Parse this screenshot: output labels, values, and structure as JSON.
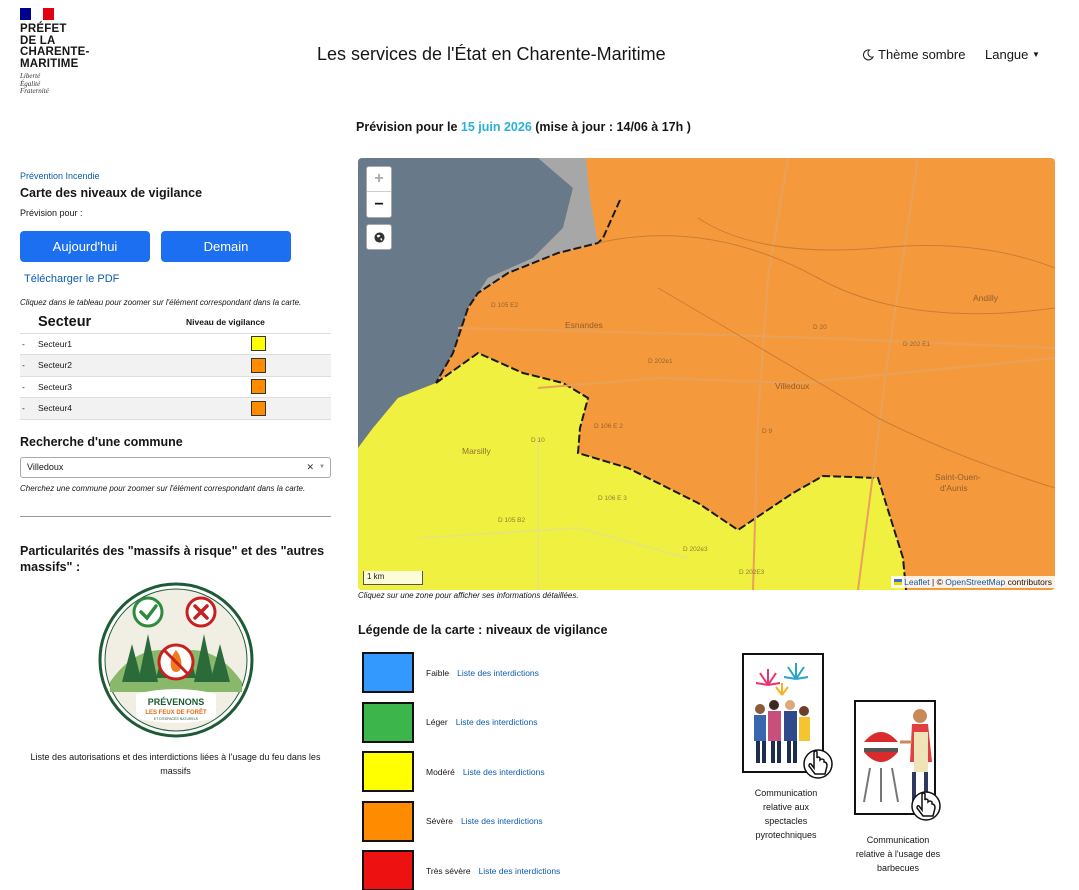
{
  "header": {
    "logo_line1": "PRÉFET",
    "logo_line2": "DE LA",
    "logo_line3": "CHARENTE-",
    "logo_line4": "MARITIME",
    "motto1": "Liberté",
    "motto2": "Égalité",
    "motto3": "Fraternité",
    "title": "Les services de l'État en Charente-Maritime",
    "theme_label": "Thème sombre",
    "language_label": "Langue"
  },
  "sidebar": {
    "breadcrumb": "Prévention Incendie",
    "title": "Carte des niveaux de vigilance",
    "forecast_for": "Prévision pour :",
    "today_button": "Aujourd'hui",
    "tomorrow_button": "Demain",
    "pdf_link": "Télécharger le PDF",
    "table_hint": "Cliquez dans le tableau pour zoomer sur l'élément correspondant dans la carte.",
    "col_sector": "Secteur",
    "col_level": "Niveau de vigilance",
    "sectors": [
      {
        "dash": "-",
        "name": "Secteur1",
        "color": "#ffff00"
      },
      {
        "dash": "-",
        "name": "Secteur2",
        "color": "#ff8c00"
      },
      {
        "dash": "-",
        "name": "Secteur3",
        "color": "#ff8c00"
      },
      {
        "dash": "-",
        "name": "Secteur4",
        "color": "#ff8c00"
      }
    ],
    "search_title": "Recherche d'une commune",
    "search_value": "Villedoux",
    "search_hint": "Cherchez une commune pour zoomer sur l'élément correspondant dans la carte.",
    "massifs_title": "Particularités des \"massifs à risque\" et des \"autres massifs\" :",
    "badge_line1": "PRÉVENONS",
    "badge_line2": "LES FEUX DE FORÊT",
    "badge_line3": "ET D'ESPACES NATURELS",
    "massifs_caption": "Liste des autorisations et des interdictions liées à l'usage du feu dans les massifs"
  },
  "main": {
    "forecast_prefix": "Prévision pour le",
    "forecast_date": "15 juin 2026",
    "forecast_update": "(mise à jour : 14/06 à 17h )",
    "map_hint": "Cliquez sur une zone pour afficher ses informations détaillées.",
    "legend_title": "Légende de la carte : niveaux de vigilance",
    "legend": [
      {
        "label": "Faible",
        "link": "Liste des interdictions",
        "color": "#3399ff"
      },
      {
        "label": "Léger",
        "link": "Liste des interdictions",
        "color": "#3cb54a"
      },
      {
        "label": "Modéré",
        "link": "Liste des interdictions",
        "color": "#ffff00"
      },
      {
        "label": "Sévère",
        "link": "Liste des interdictions",
        "color": "#ff8c00"
      },
      {
        "label": "Très sévère",
        "link": "Liste des interdictions",
        "color": "#ee1111"
      }
    ],
    "comm_fireworks": "Communication relative aux spectacles pyrotechniques",
    "comm_bbq": "Communication relative à l'usage des barbecues"
  },
  "map": {
    "zoom_in": "+",
    "zoom_out": "−",
    "scale": "1 km",
    "attribution_leaflet": "Leaflet",
    "attribution_sep": " | © ",
    "attribution_osm": "OpenStreetMap",
    "attribution_contrib": " contributors",
    "places": [
      "Esnandes",
      "Andilly",
      "Villedoux",
      "Marsilly",
      "Saint-Ouen-",
      "d'Aunis"
    ],
    "roads": [
      "D 105 E2",
      "D 20",
      "D 202 E1",
      "D 202e1",
      "D 106 E 2",
      "D 9",
      "D 10",
      "D 106 E 3",
      "D 105 B2",
      "D 202e3",
      "D 202E3"
    ],
    "colors": {
      "sea": "#687a8a",
      "grey": "#a7a7a7",
      "severe": "#f59a3c",
      "moderate": "#f0f040",
      "border": "#1a1a1a"
    }
  }
}
